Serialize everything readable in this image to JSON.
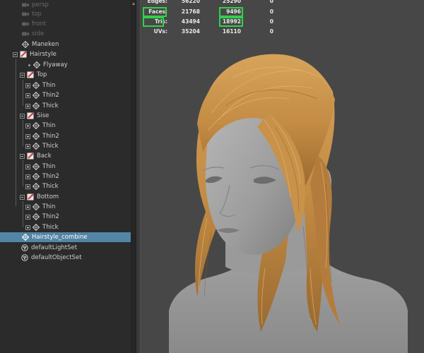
{
  "outliner": {
    "items": [
      {
        "id": "persp",
        "label": "persp",
        "type": "camera",
        "state": "dim"
      },
      {
        "id": "top",
        "label": "top",
        "type": "camera",
        "state": "dim"
      },
      {
        "id": "front",
        "label": "front",
        "type": "camera",
        "state": "dim"
      },
      {
        "id": "side",
        "label": "side",
        "type": "camera",
        "state": "dim"
      },
      {
        "id": "maneken",
        "label": "Maneken",
        "type": "mesh"
      },
      {
        "id": "hairstyle",
        "label": "Hairstyle",
        "type": "group",
        "expanded": true
      },
      {
        "id": "flyaway",
        "label": "Flyaway",
        "type": "mesh"
      },
      {
        "id": "top-group",
        "label": "Top",
        "type": "group",
        "expanded": true
      },
      {
        "id": "top-thin",
        "label": "Thin",
        "type": "mesh"
      },
      {
        "id": "top-thin2",
        "label": "Thin2",
        "type": "mesh"
      },
      {
        "id": "top-thick",
        "label": "Thick",
        "type": "mesh"
      },
      {
        "id": "sise-group",
        "label": "Sise",
        "type": "group",
        "expanded": true
      },
      {
        "id": "sise-thin",
        "label": "Thin",
        "type": "mesh"
      },
      {
        "id": "sise-thin2",
        "label": "Thin2",
        "type": "mesh"
      },
      {
        "id": "sise-thick",
        "label": "Thick",
        "type": "mesh"
      },
      {
        "id": "back-group",
        "label": "Back",
        "type": "group",
        "expanded": true
      },
      {
        "id": "back-thin",
        "label": "Thin",
        "type": "mesh"
      },
      {
        "id": "back-thin2",
        "label": "Thin2",
        "type": "mesh"
      },
      {
        "id": "back-thick",
        "label": "Thick",
        "type": "mesh"
      },
      {
        "id": "bottom-group",
        "label": "Bottom",
        "type": "group",
        "expanded": true
      },
      {
        "id": "bottom-thin",
        "label": "Thin",
        "type": "mesh"
      },
      {
        "id": "bottom-thin2",
        "label": "Thin2",
        "type": "mesh"
      },
      {
        "id": "bottom-thick",
        "label": "Thick",
        "type": "mesh"
      },
      {
        "id": "hairstyle-combine",
        "label": "Hairstyle_combine",
        "type": "mesh",
        "state": "selected"
      },
      {
        "id": "default-light-set",
        "label": "defaultLightSet",
        "type": "set"
      },
      {
        "id": "default-object-set",
        "label": "defaultObjectSet",
        "type": "set"
      }
    ],
    "selection_color": "#5285a6"
  },
  "hud": {
    "rows": [
      {
        "label": "Edges:",
        "c1": "56220",
        "c2": "25290",
        "c3": "0"
      },
      {
        "label": "Faces:",
        "c1": "21768",
        "c2": "9496",
        "c3": "0"
      },
      {
        "label": "Tris:",
        "c1": "43494",
        "c2": "18992",
        "c3": "0"
      },
      {
        "label": "UVs:",
        "c1": "35204",
        "c2": "16110",
        "c3": "0"
      }
    ],
    "highlight_color": "#2ed24a"
  },
  "viewport": {
    "background_color": "#474747",
    "hair_color": "#c8924a",
    "skin_color": "#a6a6a6"
  }
}
